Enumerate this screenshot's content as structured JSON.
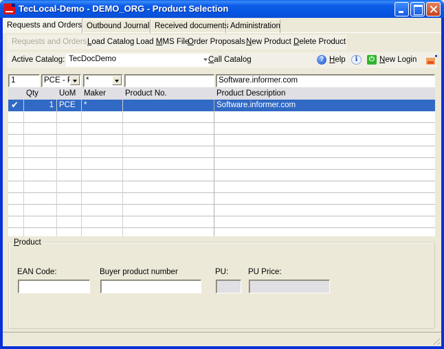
{
  "window": {
    "title": "TecLocal-Demo - DEMO_ORG - Product Selection",
    "icon": "app-logo-icon"
  },
  "tabs": [
    {
      "label": "Requests and Orders",
      "active": true
    },
    {
      "label": "Outbound Journal",
      "active": false
    },
    {
      "label": "Received documents",
      "active": false
    },
    {
      "label": "Administration",
      "active": false
    }
  ],
  "toolbar": {
    "items": [
      {
        "label": "Requests and Orders",
        "disabled": true
      },
      {
        "label": "Load Catalog",
        "accel": "L"
      },
      {
        "label": "Load MMS File",
        "accel": "M"
      },
      {
        "label": "Order Proposals",
        "accel": "O"
      },
      {
        "label": "New Product",
        "accel": "N"
      },
      {
        "label": "Delete Product",
        "accel": "D"
      }
    ]
  },
  "catalog_bar": {
    "active_catalog_label": "Active Catalog:",
    "active_catalog_value": "TecDocDemo",
    "call_catalog_label": "Call Catalog",
    "help_label": "Help",
    "info_icon": "info-icon",
    "new_login_label": "New Login",
    "teleservice_icon": "teleservice-icon"
  },
  "filter_row": {
    "qty": "1",
    "uom": "PCE - Pi",
    "maker": "*",
    "product_no": "",
    "description": "Software.informer.com"
  },
  "grid": {
    "columns": [
      "",
      "Qty",
      "UoM",
      "Maker",
      "Product No.",
      "Product Description"
    ],
    "rows": [
      {
        "checked": true,
        "qty": "1",
        "uom": "PCE",
        "maker": "*",
        "product_no": "",
        "description": "Software.informer.com",
        "selected": true
      }
    ],
    "empty_rows": 10
  },
  "product_group": {
    "title": "Product",
    "ean_label": "EAN Code:",
    "ean_value": "",
    "buyer_label": "Buyer product number",
    "buyer_value": "",
    "pu_label": "PU:",
    "pu_value": "",
    "pu_price_label": "PU Price:",
    "pu_price_value": ""
  },
  "colors": {
    "titlebar": "#0a56e0",
    "selection": "#316ac5",
    "face": "#ece9d8"
  }
}
